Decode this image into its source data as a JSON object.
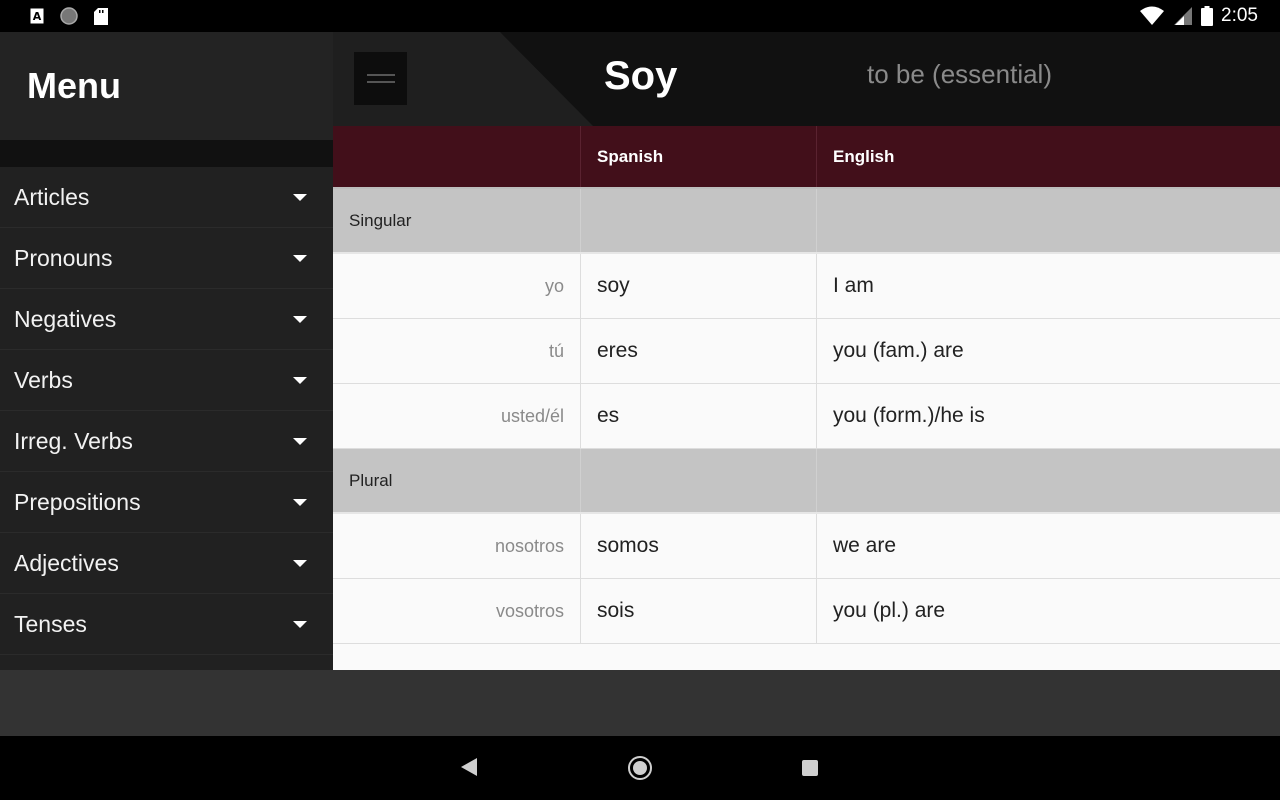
{
  "status_bar": {
    "time": "2:05",
    "left_icons": [
      "font-icon",
      "circle-icon",
      "sd-card-icon"
    ],
    "right_icons": [
      "wifi-icon",
      "signal-icon",
      "battery-icon"
    ]
  },
  "sidebar": {
    "title": "Menu",
    "items": [
      {
        "label": "Articles"
      },
      {
        "label": "Pronouns"
      },
      {
        "label": "Negatives"
      },
      {
        "label": "Verbs"
      },
      {
        "label": "Irreg. Verbs"
      },
      {
        "label": "Prepositions"
      },
      {
        "label": "Adjectives"
      },
      {
        "label": "Tenses"
      }
    ]
  },
  "header": {
    "title": "Soy",
    "subtitle": "to be (essential)"
  },
  "table": {
    "columns": [
      "",
      "Spanish",
      "English"
    ],
    "sections": [
      {
        "label": "Singular",
        "rows": [
          {
            "pronoun": "yo",
            "spanish": "soy",
            "english": "I am"
          },
          {
            "pronoun": "tú",
            "spanish": "eres",
            "english": "you (fam.) are"
          },
          {
            "pronoun": "usted/él",
            "spanish": "es",
            "english": "you (form.)/he is"
          }
        ]
      },
      {
        "label": "Plural",
        "rows": [
          {
            "pronoun": "nosotros",
            "spanish": "somos",
            "english": "we are"
          },
          {
            "pronoun": "vosotros",
            "spanish": "sois",
            "english": "you (pl.) are"
          }
        ]
      }
    ]
  },
  "colors": {
    "header_row": "#420f1a",
    "section_row": "#c4c4c4",
    "sidebar_bg": "#212121",
    "topbar_bg": "#111111"
  }
}
